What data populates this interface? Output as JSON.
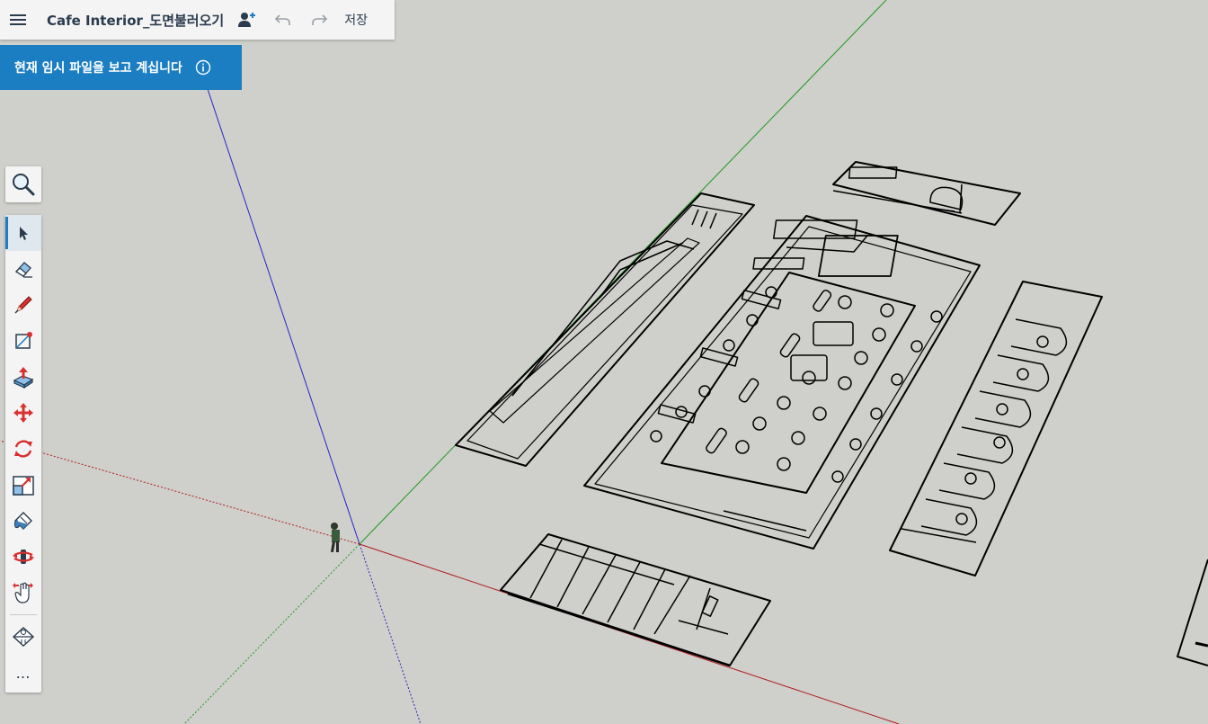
{
  "app": {
    "document_title": "Cafe Interior_도면불러오기",
    "save_label": "저장"
  },
  "banner": {
    "message": "현재 임시 파일을 보고 계십니다"
  },
  "icons": {
    "menu": "hamburger-menu-icon",
    "share": "add-person-icon",
    "undo": "undo-icon",
    "redo": "redo-icon",
    "info": "info-icon",
    "search": "search-icon"
  },
  "toolbar": {
    "tools": [
      "select",
      "eraser",
      "line",
      "rectangle",
      "push-pull",
      "move",
      "rotate",
      "scale",
      "paint-bucket",
      "orbit",
      "pan",
      "section-plane"
    ],
    "active_tool": "select",
    "more_label": "…"
  },
  "colors": {
    "accent": "#1b7ec2",
    "background": "#cfcfcb",
    "axis_red": "#b01c1c",
    "axis_green": "#1f9a1f",
    "axis_blue": "#2626c8"
  }
}
